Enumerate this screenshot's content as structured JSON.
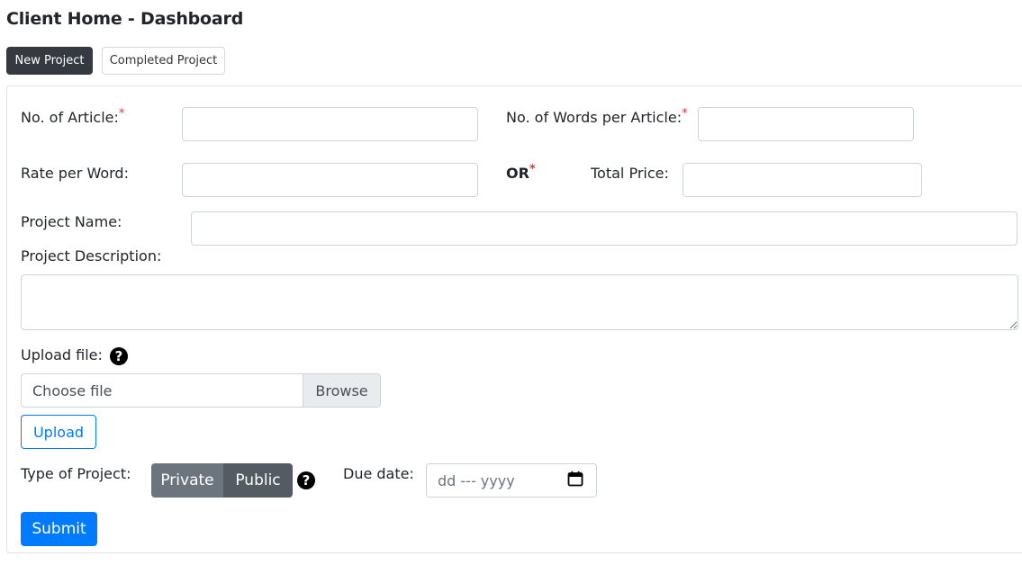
{
  "header": {
    "title": "Client Home - Dashboard"
  },
  "tabs": [
    {
      "label": "New Project",
      "active": true
    },
    {
      "label": "Completed Project",
      "active": false
    }
  ],
  "form": {
    "articles": {
      "label": "No. of Article:",
      "required_mark": "*",
      "value": ""
    },
    "words": {
      "label": "No. of Words per Article:",
      "required_mark": "*",
      "value": ""
    },
    "rate": {
      "label": "Rate per Word:",
      "value": ""
    },
    "or": {
      "label": "OR",
      "required_mark": "*"
    },
    "total": {
      "label": "Total Price:",
      "value": ""
    },
    "project_name": {
      "label": "Project Name:",
      "value": ""
    },
    "project_description": {
      "label": "Project Description:",
      "value": ""
    },
    "upload": {
      "label": "Upload file:",
      "help_icon": "question-circle-icon",
      "placeholder": "Choose file",
      "browse_label": "Browse",
      "button_label": "Upload"
    },
    "project_type": {
      "label": "Type of Project:",
      "options": [
        "Private",
        "Public"
      ],
      "help_icon": "question-circle-icon"
    },
    "due_date": {
      "label": "Due date:",
      "placeholder": "dd --- yyyy",
      "icon": "calendar-icon"
    },
    "submit_label": "Submit"
  },
  "colors": {
    "primary": "#007bff",
    "dark": "#343a40",
    "secondary": "#6c757d",
    "required": "#dc3545"
  }
}
